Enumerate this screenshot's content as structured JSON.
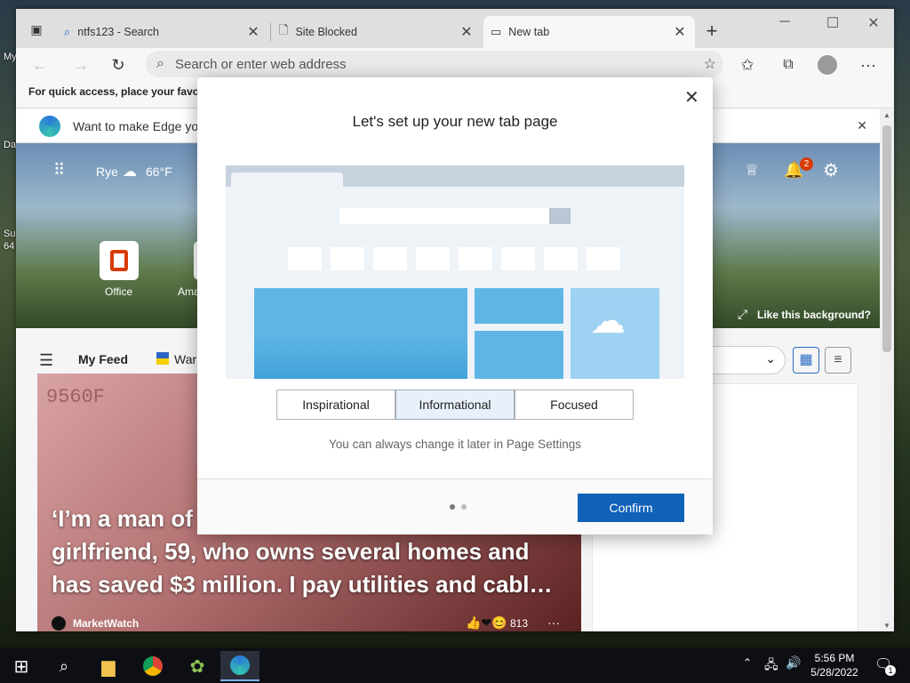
{
  "desktop": {
    "icons": [
      "My",
      "Da",
      "Su",
      "64"
    ]
  },
  "tabs": [
    {
      "label": "ntfs123 - Search",
      "icon": "search-icon"
    },
    {
      "label": "Site Blocked",
      "icon": "page-icon"
    },
    {
      "label": "New tab",
      "icon": "newtab-icon"
    }
  ],
  "toolbar": {
    "address_placeholder": "Search or enter web address"
  },
  "favorites_bar": {
    "text": "For quick access, place your favorit"
  },
  "promo": {
    "text": "Want to make Edge yo"
  },
  "newtab": {
    "location": "Rye",
    "temperature": "66°F",
    "notifications": "2",
    "quicklinks": [
      "Office",
      "Ama"
    ],
    "background_link": "Like this background?",
    "feed_tab": "My Feed",
    "feed_tab2": "War",
    "card": {
      "watermark": "9560F",
      "headline": "‘I’m a man of … girlfriend, 59, who owns several homes and has saved $3 million. I pay utilities and cabl…",
      "headline_l1": "‘I’m a man of",
      "headline_l2": "girlfriend, 59, who owns several homes and",
      "headline_l3": "has saved $3 million. I pay utilities and cabl…",
      "source": "MarketWatch",
      "reactions": "813",
      "more": "···"
    }
  },
  "dialog": {
    "title": "Let's set up your new tab page",
    "options": [
      "Inspirational",
      "Informational",
      "Focused"
    ],
    "selected": "Informational",
    "note": "You can always change it later in Page Settings",
    "confirm": "Confirm"
  },
  "taskbar": {
    "time": "5:56 PM",
    "date": "5/28/2022",
    "notification_count": "1"
  },
  "colors": {
    "accent": "#0f62b8",
    "preview_blue": "#5fb6e6"
  }
}
